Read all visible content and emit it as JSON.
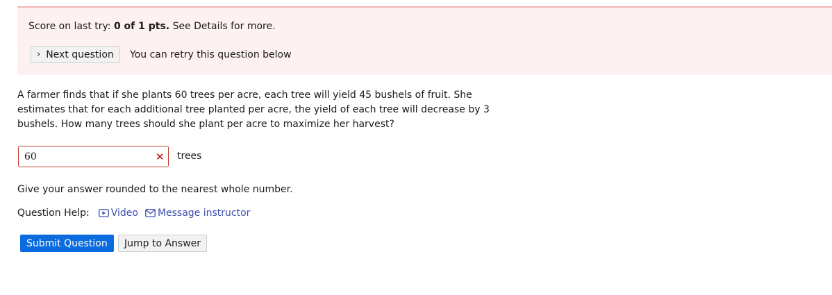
{
  "banner": {
    "score_prefix": "Score on last try: ",
    "score_value": "0 of 1 pts.",
    "score_suffix": " See Details for more.",
    "next_question_label": "Next question",
    "retry_text": "You can retry this question below"
  },
  "question": {
    "text": "A farmer finds that if she plants 60 trees per acre, each tree will yield 45 bushels of fruit. She estimates that for each additional tree planted per acre, the yield of each tree will decrease by 3 bushels. How many trees should she plant per acre to maximize her harvest?"
  },
  "answer": {
    "value": "60",
    "status_icon": "incorrect-x-icon",
    "unit": "trees"
  },
  "hint": "Give your answer rounded to the nearest whole number.",
  "help": {
    "label": "Question Help:",
    "video_label": "Video",
    "message_label": "Message instructor"
  },
  "actions": {
    "submit_label": "Submit Question",
    "jump_label": "Jump to Answer"
  },
  "colors": {
    "banner_bg": "#fdf1f1",
    "banner_border": "#f3b3b3",
    "error": "#c0392b",
    "link": "#3d4eb0",
    "primary": "#0a6cdf"
  }
}
